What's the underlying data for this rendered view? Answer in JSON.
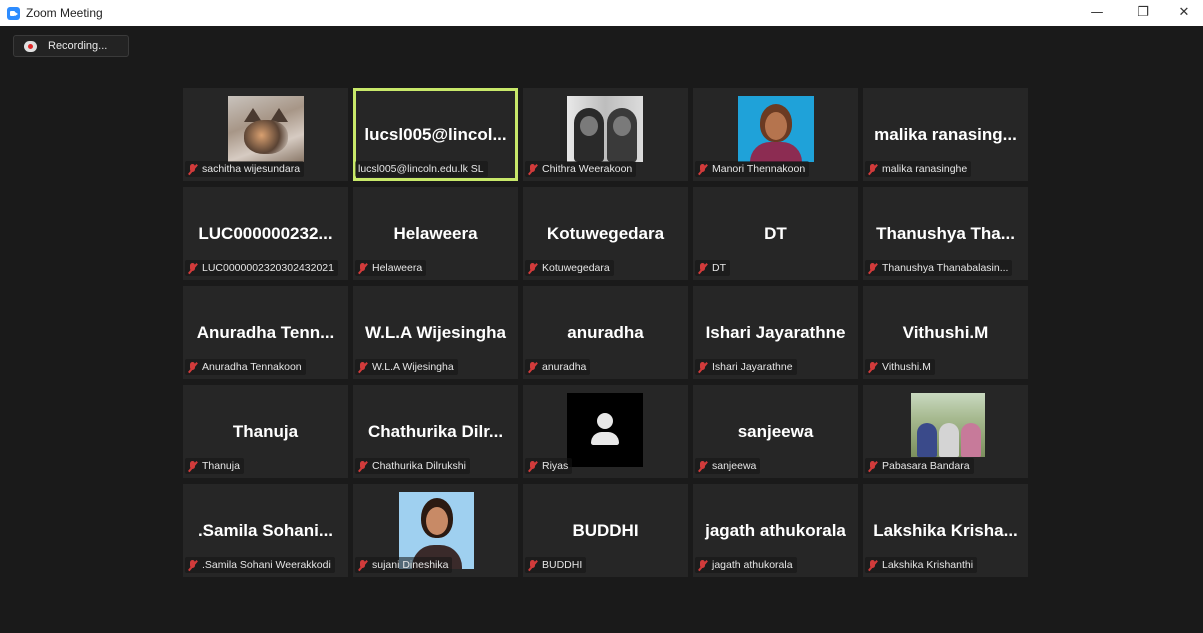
{
  "window": {
    "title": "Zoom Meeting",
    "minimize": "—",
    "maximize": "❐",
    "close": "✕"
  },
  "recording": {
    "label": "Recording..."
  },
  "accent": "#c8e86a",
  "participants": [
    {
      "display": "",
      "name": "sachitha wijesundara",
      "avatar": "cat-photo",
      "muted": true
    },
    {
      "display": "lucsl005@lincol...",
      "name": "lucsl005@lincoln.edu.lk SL",
      "avatar": "",
      "muted": false,
      "active_speaker": true
    },
    {
      "display": "",
      "name": "Chithra Weerakoon",
      "avatar": "couple-photo",
      "muted": true
    },
    {
      "display": "",
      "name": "Manori Thennakoon",
      "avatar": "portrait-photo",
      "muted": true
    },
    {
      "display": "malika ranasing...",
      "name": "malika ranasinghe",
      "avatar": "",
      "muted": true
    },
    {
      "display": "LUC000000232...",
      "name": "LUC0000002320302432021",
      "avatar": "",
      "muted": true
    },
    {
      "display": "Helaweera",
      "name": "Helaweera",
      "avatar": "",
      "muted": true
    },
    {
      "display": "Kotuwegedara",
      "name": "Kotuwegedara",
      "avatar": "",
      "muted": true
    },
    {
      "display": "DT",
      "name": "DT",
      "avatar": "",
      "muted": true
    },
    {
      "display": "Thanushya Tha...",
      "name": "Thanushya Thanabalasin...",
      "avatar": "",
      "muted": true
    },
    {
      "display": "Anuradha Tenn...",
      "name": "Anuradha Tennakoon",
      "avatar": "",
      "muted": true
    },
    {
      "display": "W.L.A Wijesingha",
      "name": "W.L.A Wijesingha",
      "avatar": "",
      "muted": true
    },
    {
      "display": "anuradha",
      "name": "anuradha",
      "avatar": "",
      "muted": true
    },
    {
      "display": "Ishari Jayarathne",
      "name": "Ishari Jayarathne",
      "avatar": "",
      "muted": true
    },
    {
      "display": "Vithushi.M",
      "name": "Vithushi.M",
      "avatar": "",
      "muted": true
    },
    {
      "display": "Thanuja",
      "name": "Thanuja",
      "avatar": "",
      "muted": true
    },
    {
      "display": "Chathurika Dilr...",
      "name": "Chathurika Dilrukshi",
      "avatar": "",
      "muted": true
    },
    {
      "display": "",
      "name": "Riyas",
      "avatar": "default-avatar",
      "muted": true
    },
    {
      "display": "sanjeewa",
      "name": "sanjeewa",
      "avatar": "",
      "muted": true
    },
    {
      "display": "",
      "name": "Pabasara Bandara",
      "avatar": "group-photo",
      "muted": true
    },
    {
      "display": ".Samila Sohani...",
      "name": ".Samila Sohani Weerakkodi",
      "avatar": "",
      "muted": true
    },
    {
      "display": "",
      "name": "sujani Dineshika",
      "avatar": "portrait-photo-2",
      "muted": true
    },
    {
      "display": "BUDDHI",
      "name": "BUDDHI",
      "avatar": "",
      "muted": true
    },
    {
      "display": "jagath athukorala",
      "name": "jagath athukorala",
      "avatar": "",
      "muted": true
    },
    {
      "display": "Lakshika Krisha...",
      "name": "Lakshika Krishanthi",
      "avatar": "",
      "muted": true
    }
  ]
}
